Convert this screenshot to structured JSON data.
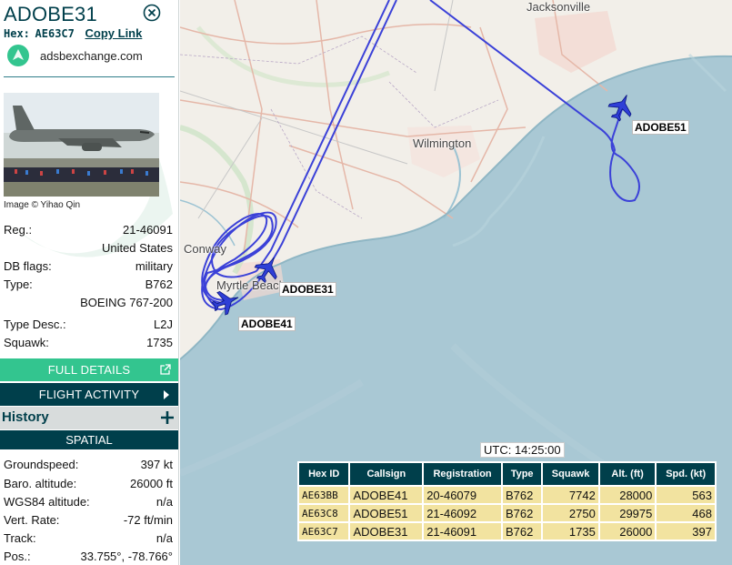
{
  "aircraft": {
    "callsign": "ADOBE31",
    "hex_label": "Hex:",
    "hex": "AE63C7",
    "copy_link": "Copy Link",
    "source": "adsbexchange.com",
    "photo_credit": "Image © Yihao Qin"
  },
  "details": [
    {
      "label": "Reg.:",
      "value": "21-46091"
    },
    {
      "label": "",
      "value": "United States"
    },
    {
      "label": "DB flags:",
      "value": "military"
    },
    {
      "label": "Type:",
      "value": "B762"
    },
    {
      "label": "",
      "value": "BOEING 767-200"
    },
    {
      "label": "Type Desc.:",
      "value": "L2J"
    },
    {
      "label": "Squawk:",
      "value": "1735"
    }
  ],
  "buttons": {
    "full_details": "FULL DETAILS",
    "flight_activity": "FLIGHT ACTIVITY",
    "history": "History",
    "spatial": "SPATIAL"
  },
  "spatial": [
    {
      "label": "Groundspeed:",
      "value": "397 kt"
    },
    {
      "label": "Baro. altitude:",
      "value": "26000 ft"
    },
    {
      "label": "WGS84 altitude:",
      "value": "n/a"
    },
    {
      "label": "Vert. Rate:",
      "value": "-72 ft/min"
    },
    {
      "label": "Track:",
      "value": "n/a"
    },
    {
      "label": "Pos.:",
      "value": "33.755°, -78.766°"
    }
  ],
  "map": {
    "cities": [
      "Jacksonville",
      "Wilmington",
      "Conway",
      "Myrtle Beach"
    ],
    "plane_labels": [
      "ADOBE51",
      "ADOBE31",
      "ADOBE41"
    ],
    "utc": "UTC: 14:25:00",
    "colors": {
      "water": "#a9c8d4",
      "land": "#f2efe9",
      "track": "#3b41d8",
      "plane": "#2f3fd6"
    }
  },
  "table": {
    "headers": [
      "Hex ID",
      "Callsign",
      "Registration",
      "Type",
      "Squawk",
      "Alt. (ft)",
      "Spd. (kt)"
    ],
    "rows": [
      [
        "AE63BB",
        "ADOBE41",
        "20-46079",
        "B762",
        "7742",
        "28000",
        "563"
      ],
      [
        "AE63C8",
        "ADOBE51",
        "21-46092",
        "B762",
        "2750",
        "29975",
        "468"
      ],
      [
        "AE63C7",
        "ADOBE31",
        "21-46091",
        "B762",
        "1735",
        "26000",
        "397"
      ]
    ]
  }
}
